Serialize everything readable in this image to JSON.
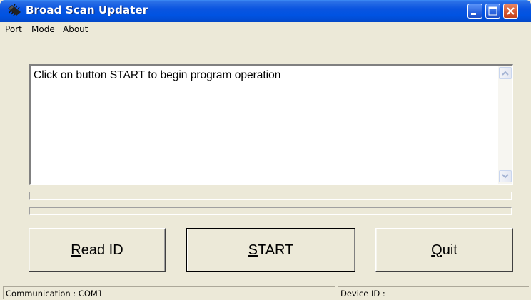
{
  "window": {
    "title": "Broad Scan Updater",
    "icons": [
      "app-icon",
      "minimize-icon",
      "maximize-icon",
      "close-icon"
    ]
  },
  "menu": {
    "port": {
      "accel": "P",
      "rest": "ort"
    },
    "mode": {
      "accel": "M",
      "rest": "ode"
    },
    "about": {
      "accel": "A",
      "rest": "bout"
    }
  },
  "output": {
    "text": "Click on button START to begin program operation"
  },
  "progress": {
    "bar1": 0,
    "bar2": 0
  },
  "buttons": {
    "read_id": {
      "accel": "R",
      "rest": "ead ID"
    },
    "start": {
      "accel": "S",
      "rest": "TART"
    },
    "quit": {
      "accel": "Q",
      "rest": "uit"
    }
  },
  "status": {
    "communication": "Communication : COM1",
    "device_id": "Device ID :"
  },
  "colors": {
    "titlebar": "#0053e2",
    "face": "#ece9d8",
    "close_button": "#d65a32"
  }
}
